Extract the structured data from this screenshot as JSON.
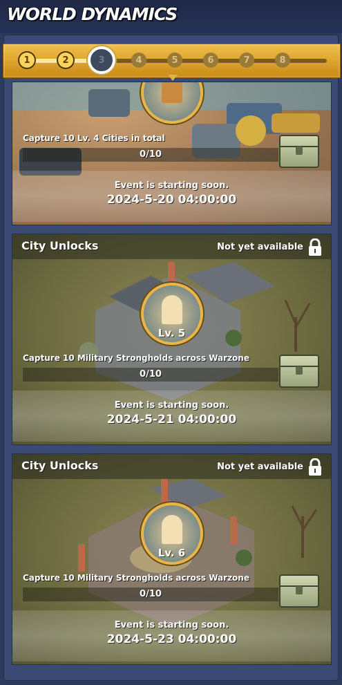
{
  "header": {
    "title": "WORLD DYNAMICS"
  },
  "progress": {
    "steps": [
      "1",
      "2",
      "3",
      "4",
      "5",
      "6",
      "7",
      "8"
    ],
    "completed_steps": 2,
    "current_step": 3
  },
  "cards": [
    {
      "task": "Capture 10 Lv. 4 Cities in total",
      "progress_text": "0/10",
      "progress_value": 0,
      "status_label": "Event is starting soon.",
      "status_date": "2024-5-20 04:00:00"
    },
    {
      "title": "City Unlocks",
      "availability": "Not yet available",
      "badge_level": "Lv. 5",
      "task": "Capture 10 Military Strongholds across Warzone",
      "progress_text": "0/10",
      "progress_value": 0,
      "status_label": "Event is starting soon.",
      "status_date": "2024-5-21 04:00:00"
    },
    {
      "title": "City Unlocks",
      "availability": "Not yet available",
      "badge_level": "Lv. 6",
      "task": "Capture 10 Military Strongholds across Warzone",
      "progress_text": "0/10",
      "progress_value": 0,
      "status_label": "Event is starting soon.",
      "status_date": "2024-5-23 04:00:00"
    }
  ],
  "icons": {
    "lock": "lock-icon",
    "chest": "reward-chest-icon",
    "badge": "city-badge-icon"
  },
  "colors": {
    "progress_gold": "#e2b24a",
    "badge_ring": "#e7b54a",
    "background": "#2c3a5c"
  }
}
